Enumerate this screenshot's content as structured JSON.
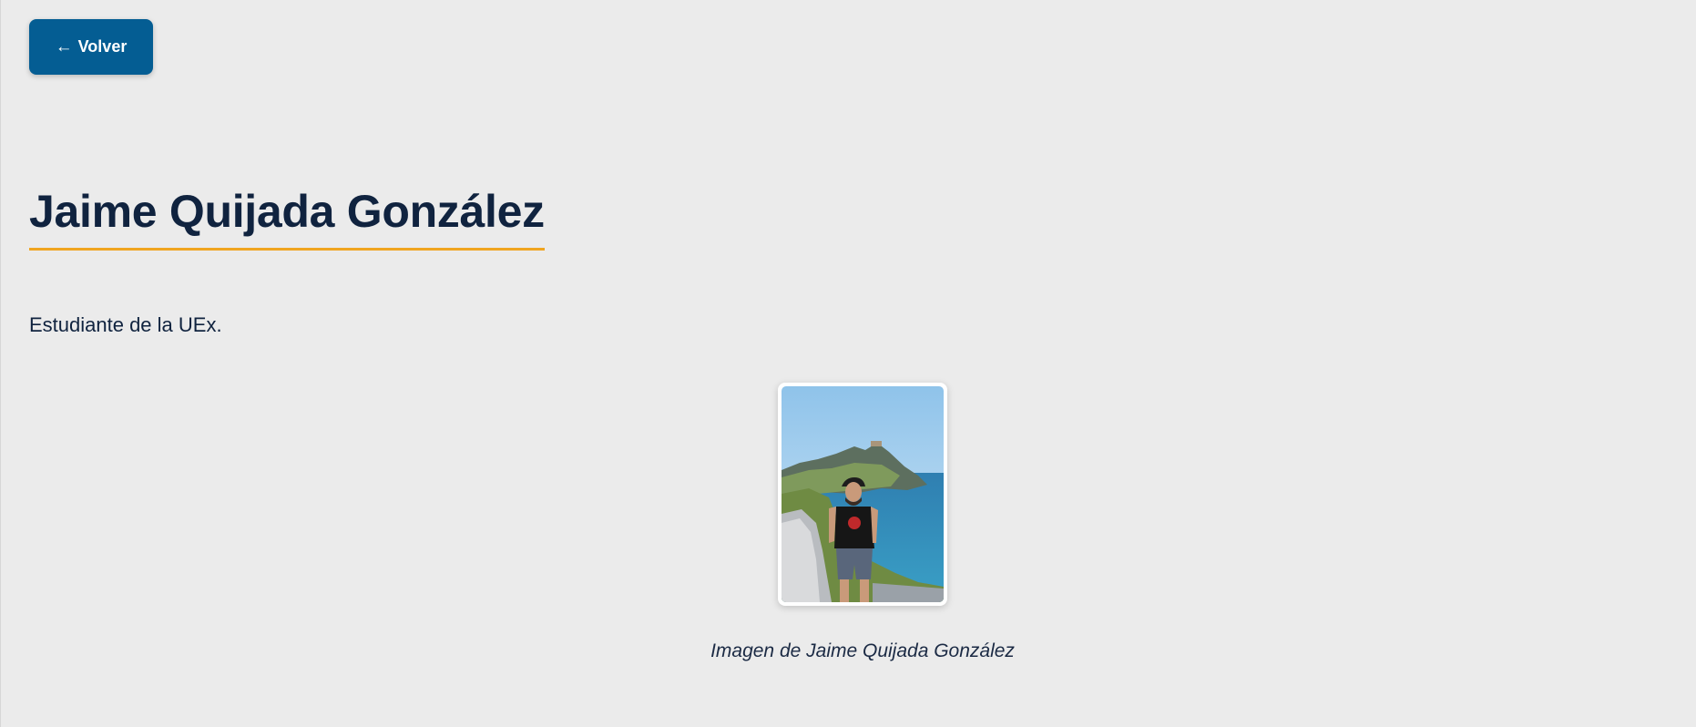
{
  "back_button": {
    "arrow": "←",
    "label": "Volver"
  },
  "profile": {
    "name": "Jaime Quijada González",
    "description": "Estudiante de la UEx.",
    "image_caption": "Imagen de Jaime Quijada González",
    "image_alt": "Jaime Quijada González"
  },
  "colors": {
    "page_background": "#ebebeb",
    "button_background": "#045d93",
    "title_text": "#10233f",
    "title_underline": "#f0a520"
  }
}
